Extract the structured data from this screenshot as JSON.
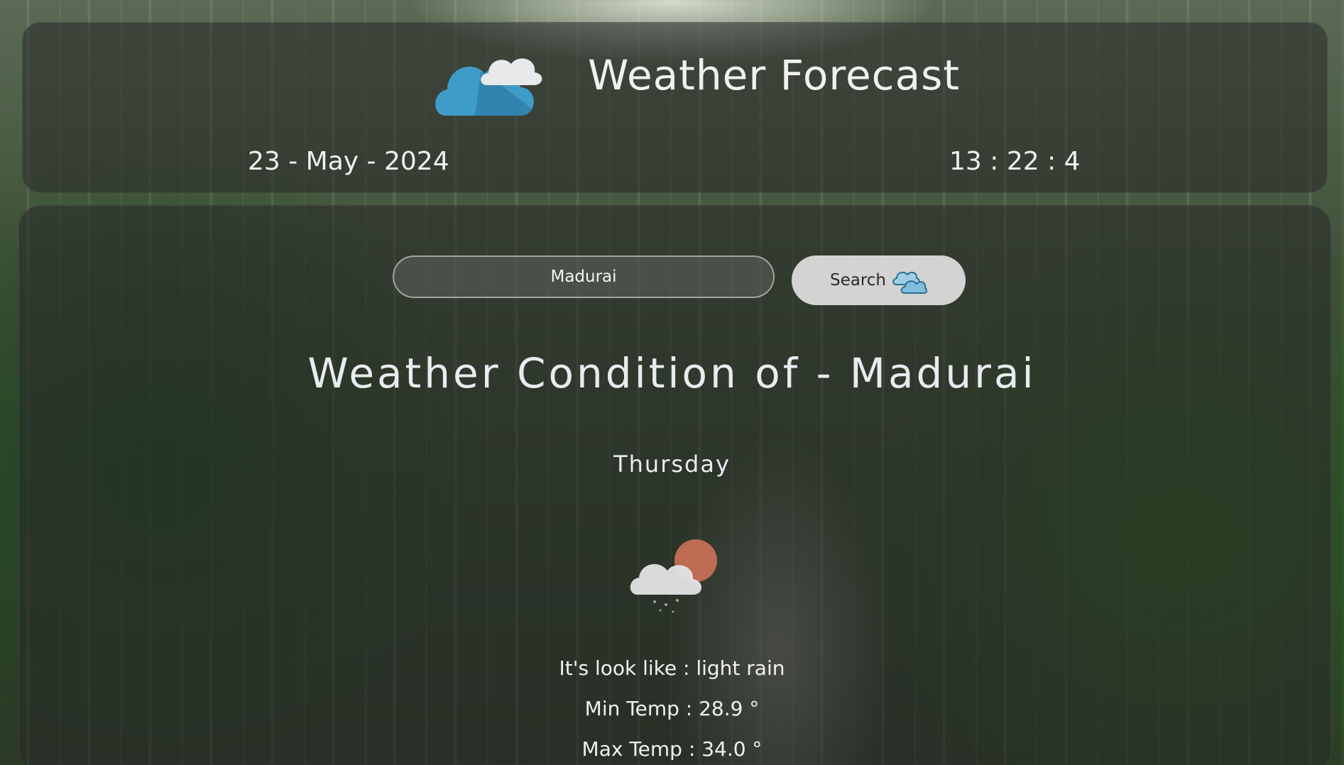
{
  "header": {
    "title": "Weather Forecast",
    "date": "23 - May - 2024",
    "time": "13 : 22 : 4",
    "logo_icon": "cloud-icon"
  },
  "search": {
    "value": "Madurai",
    "placeholder": "",
    "button_label": "Search",
    "button_icon": "clouds-icon"
  },
  "condition": {
    "title": "Weather Condition of - Madurai",
    "day": "Thursday",
    "icon": "light-rain-icon",
    "look_label": "It's look like : light rain",
    "min_temp_label": "Min Temp : 28.9 °",
    "max_temp_label": "Max Temp : 34.0 °"
  },
  "colors": {
    "logo_blue": "#3f9cc9",
    "logo_light": "#e9ecef",
    "sun_orange": "#d8765a"
  }
}
